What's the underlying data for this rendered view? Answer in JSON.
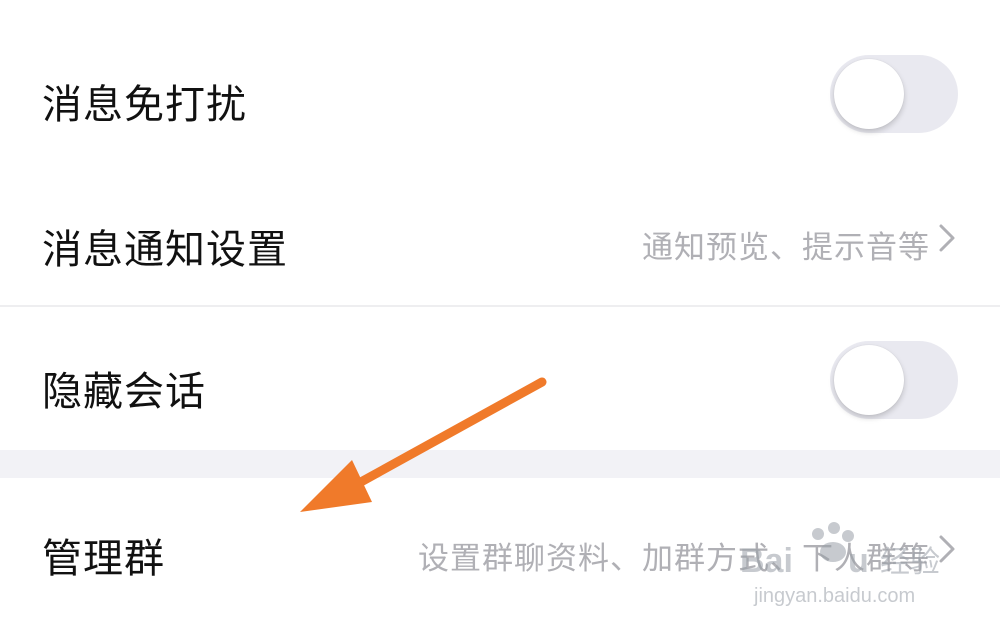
{
  "settings": {
    "items": [
      {
        "label": "消息免打扰",
        "control": "toggle",
        "checked": false
      },
      {
        "label": "消息通知设置",
        "detail": "通知预览、提示音等"
      },
      {
        "label": "隐藏会话",
        "control": "toggle",
        "checked": false
      },
      {
        "label": "管理群",
        "detail": "设置群聊资料、加群方式、下人群等"
      }
    ]
  },
  "colors": {
    "toggle_off_track": "#e9e9f0",
    "detail_text": "#b0b0b5",
    "annotation_arrow": "#f07a2a",
    "section_gap": "#f2f2f6"
  },
  "icons": {
    "chevron": "chevron-right-icon",
    "arrow": "annotation-arrow-icon"
  },
  "watermark": {
    "brand": "Baidu",
    "brand_cn": "经验",
    "url": "jingyan.baidu.com"
  }
}
